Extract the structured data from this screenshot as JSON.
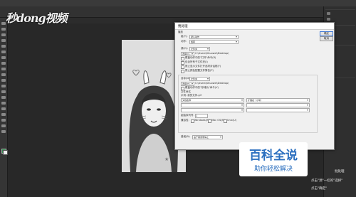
{
  "watermark": {
    "text": "秒dong视频"
  },
  "dialog": {
    "title": "批处理",
    "section_play": "播放",
    "group_label": "组(T):",
    "group_value": "默认动作",
    "action_label": "动作:",
    "action_value": "旋转",
    "source_label": "源(O):",
    "source_value": "文件夹",
    "choose_button": "选择(C)...",
    "source_path": "C:\\Users\\Shuowei\\Desktop\\",
    "source_options": [
      "覆盖动作中的\"打开\"命令(R)",
      "包含所有子文件夹(I)",
      "禁止显示文件打开选项对话框(F)",
      "禁止颜色配置文件警告(P)"
    ],
    "target_label": "目标(D):",
    "target_value": "文件夹",
    "target_choose_button": "选择(H)...",
    "target_path": "C:\\Users\\Shuowei\\Desktop\\",
    "target_option": "覆盖动作中的\"存储为\"命令(V)",
    "naming_label": "文件命名",
    "naming_example": "示例: 我的文件.gif",
    "naming_fields": [
      "文档名称",
      "扩展名（小写）",
      "",
      "",
      "",
      ""
    ],
    "start_serial_label": "起始序列号:",
    "start_serial_value": "1",
    "compat_label": "兼容性:",
    "compat_options": [
      "Windows(W)",
      "Mac OS(M)",
      "Unix(U)"
    ],
    "errors_label": "错误(B):",
    "errors_value": "由于错误而停止",
    "buttons": {
      "ok": "确定",
      "cancel": "取消"
    }
  },
  "logo": {
    "main": "百科全说",
    "sub": "助你轻松解决"
  },
  "notes": [
    "点击\"源\"一栏的\"选择\"",
    "点击\"确定\""
  ],
  "side_note": "批处理"
}
